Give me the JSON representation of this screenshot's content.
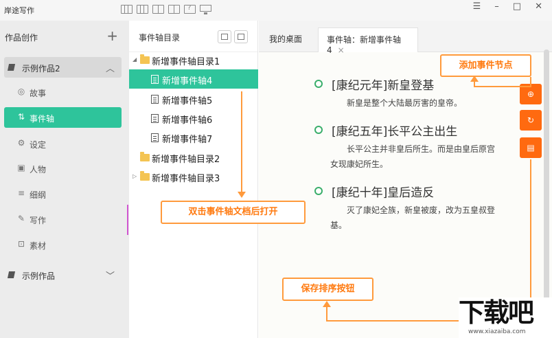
{
  "app": {
    "title": "岸途写作"
  },
  "window": {
    "menu_glyph": "☰",
    "min_glyph": "–",
    "max_glyph": "□",
    "close_glyph": "✕"
  },
  "left_panel": {
    "title": "作品创作",
    "add_glyph": "+",
    "works": [
      {
        "label": "示例作品2",
        "expanded": true
      },
      {
        "label": "示例作品",
        "expanded": false
      }
    ],
    "nav": [
      {
        "icon": "story-icon",
        "glyph": "◎",
        "label": "故事"
      },
      {
        "icon": "timeline-icon",
        "glyph": "⇅",
        "label": "事件轴"
      },
      {
        "icon": "settings-icon",
        "glyph": "⚙",
        "label": "设定"
      },
      {
        "icon": "person-card-icon",
        "glyph": "▣",
        "label": "人物"
      },
      {
        "icon": "outline-icon",
        "glyph": "≡",
        "label": "细纲"
      },
      {
        "icon": "pen-icon",
        "glyph": "✎",
        "label": "写作"
      },
      {
        "icon": "material-icon",
        "glyph": "⊡",
        "label": "素材"
      }
    ],
    "chevron_up": "︿",
    "chevron_down": "﹀"
  },
  "directory": {
    "title": "事件轴目录",
    "items": [
      {
        "type": "folder",
        "label": "新增事件轴目录1",
        "arrow": "◢"
      },
      {
        "type": "doc",
        "label": "新增事件轴4"
      },
      {
        "type": "doc",
        "label": "新增事件轴5"
      },
      {
        "type": "doc",
        "label": "新增事件轴6"
      },
      {
        "type": "doc",
        "label": "新增事件轴7"
      },
      {
        "type": "folder",
        "label": "新增事件轴目录2"
      },
      {
        "type": "folder",
        "label": "新增事件轴目录3",
        "arrow": "▷"
      }
    ]
  },
  "tabs": [
    {
      "label": "我的桌面"
    },
    {
      "label": "事件轴：新增事件轴4",
      "close": "×"
    }
  ],
  "events": [
    {
      "title": "[康纪元年]新皇登基",
      "desc": "新皇是整个大陆最厉害的皇帝。"
    },
    {
      "title": "[康纪五年]长平公主出生",
      "desc": "长平公主并非皇后所生。而是由皇后原宫女现康妃所生。"
    },
    {
      "title": "[康纪十年]皇后造反",
      "desc": "灭了康妃全族，新皇被废，改为五皇叔登基。"
    }
  ],
  "side_buttons": [
    {
      "name": "add-event-node-icon",
      "glyph": "⊕"
    },
    {
      "name": "refresh-icon",
      "glyph": "↻"
    },
    {
      "name": "save-icon",
      "glyph": "▤"
    }
  ],
  "callouts": {
    "add_node": "添加事件节点",
    "double_click": "双击事件轴文档后打开",
    "save_sort": "保存排序按钮"
  },
  "watermark": {
    "big": "下载吧",
    "small": "www.xiazaiba.com"
  },
  "colors": {
    "accent": "#2ec49b",
    "orange": "#ff6a10",
    "callout": "#ff9a3c",
    "timeline_dot": "#3aae6b"
  }
}
